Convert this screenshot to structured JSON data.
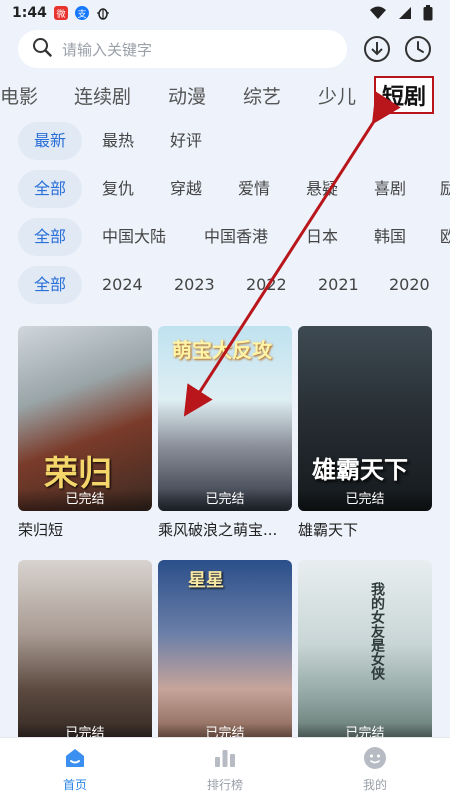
{
  "status_bar": {
    "time": "1:44",
    "icons": [
      "weibo-icon",
      "alipay-icon",
      "bug-icon",
      "wifi-icon",
      "signal-icon",
      "battery-icon"
    ]
  },
  "search": {
    "placeholder": "请输入关键字",
    "download_icon": "download-icon",
    "history_icon": "history-clock-icon"
  },
  "category_tabs": [
    {
      "label": "电影"
    },
    {
      "label": "连续剧"
    },
    {
      "label": "动漫"
    },
    {
      "label": "综艺"
    },
    {
      "label": "少儿"
    },
    {
      "label": "短剧",
      "active": true
    }
  ],
  "filters": {
    "sort": [
      "最新",
      "最热",
      "好评"
    ],
    "genre": [
      "全部",
      "复仇",
      "穿越",
      "爱情",
      "悬疑",
      "喜剧",
      "励"
    ],
    "region": [
      "全部",
      "中国大陆",
      "中国香港",
      "日本",
      "韩国",
      "欧"
    ],
    "year": [
      "全部",
      "2024",
      "2023",
      "2022",
      "2021",
      "2020"
    ]
  },
  "cards": [
    {
      "title": "荣归短",
      "status": "已完结",
      "art_text": "荣归"
    },
    {
      "title": "乘风破浪之萌宝...",
      "status": "已完结",
      "art_text": "萌宝大反攻"
    },
    {
      "title": "雄霸天下",
      "status": "已完结",
      "art_text": "雄霸天下"
    },
    {
      "title": "",
      "status": "已完结",
      "art_text": ""
    },
    {
      "title": "",
      "status": "已完结",
      "art_text": "星星"
    },
    {
      "title": "",
      "status": "已完结",
      "art_text": "我的女友是女侠"
    }
  ],
  "bottom_nav": [
    {
      "label": "首页",
      "icon": "home-icon",
      "active": true
    },
    {
      "label": "排行榜",
      "icon": "ranking-icon"
    },
    {
      "label": "我的",
      "icon": "profile-icon"
    }
  ],
  "colors": {
    "accent": "#2a6fd6",
    "highlight_box": "#b8161b",
    "arrow": "#b8161b",
    "background": "#eef3fb"
  }
}
